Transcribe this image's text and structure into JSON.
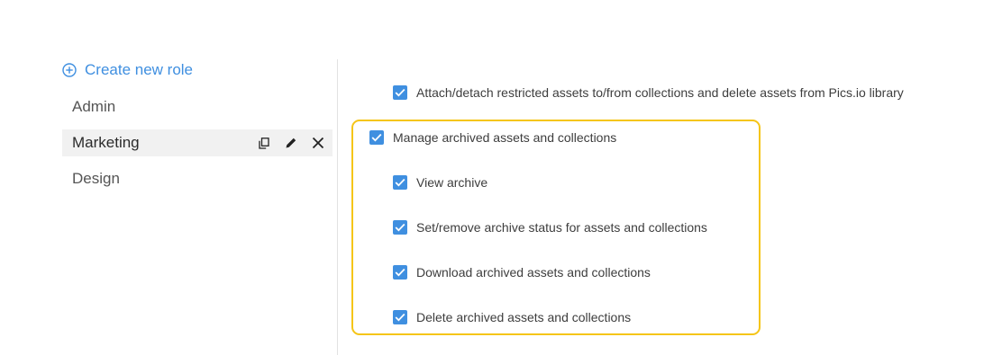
{
  "sidebar": {
    "create_label": "Create new role",
    "roles": [
      {
        "label": "Admin"
      },
      {
        "label": "Marketing"
      },
      {
        "label": "Design"
      }
    ]
  },
  "permissions": {
    "attach_detach": "Attach/detach restricted assets to/from collections and delete assets from Pics.io library",
    "manage_archived": "Manage archived assets and collections",
    "view_archive": "View archive",
    "set_remove_status": "Set/remove archive status for assets and collections",
    "download_archived": "Download archived assets and collections",
    "delete_archived": "Delete archived assets and collections"
  },
  "colors": {
    "accent": "#3f8fe0",
    "highlight_border": "#f5c518",
    "active_row_bg": "#f1f1f1"
  }
}
